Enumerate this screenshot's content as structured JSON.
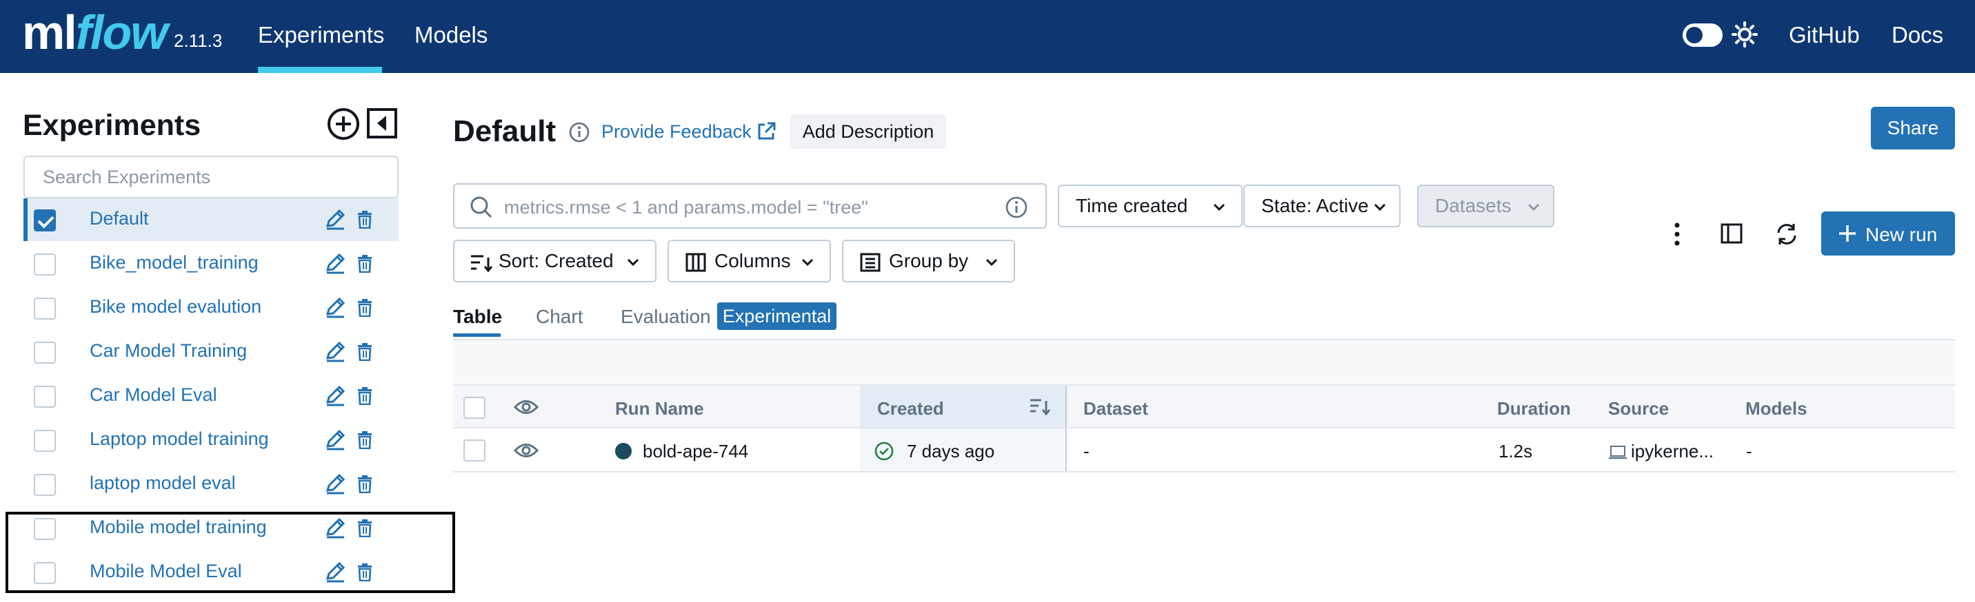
{
  "app": {
    "logo_ml": "ml",
    "logo_flow": "flow",
    "version": "2.11.3",
    "nav": [
      {
        "label": "Experiments",
        "active": true
      },
      {
        "label": "Models",
        "active": false
      }
    ],
    "right_links": [
      "GitHub",
      "Docs"
    ],
    "theme_toggle": "off",
    "colors": {
      "header": "#0e3772",
      "accent": "#43c9ed",
      "primary": "#2272b4"
    }
  },
  "sidebar": {
    "title": "Experiments",
    "search_placeholder": "Search Experiments",
    "experiments": [
      {
        "name": "Default",
        "checked": true
      },
      {
        "name": "Bike_model_training",
        "checked": false
      },
      {
        "name": "Bike model evalution",
        "checked": false
      },
      {
        "name": "Car Model Training",
        "checked": false
      },
      {
        "name": "Car Model Eval",
        "checked": false
      },
      {
        "name": "Laptop model training",
        "checked": false
      },
      {
        "name": "laptop model eval",
        "checked": false
      },
      {
        "name": "Mobile model training",
        "checked": false
      },
      {
        "name": "Mobile Model Eval",
        "checked": false
      }
    ]
  },
  "main": {
    "title": "Default",
    "feedback_label": "Provide Feedback",
    "add_description_label": "Add Description",
    "share_label": "Share",
    "search_placeholder": "metrics.rmse < 1 and params.model = \"tree\"",
    "filters": {
      "time_created": "Time created",
      "state": "State: Active",
      "datasets": "Datasets"
    },
    "sort_label": "Sort: Created",
    "columns_label": "Columns",
    "group_by_label": "Group by",
    "new_run_label": "New run",
    "tabs": [
      {
        "label": "Table",
        "active": true
      },
      {
        "label": "Chart",
        "active": false
      },
      {
        "label": "Evaluation",
        "active": false
      }
    ],
    "experimental_badge": "Experimental",
    "table": {
      "headers": [
        "Run Name",
        "Created",
        "Dataset",
        "Duration",
        "Source",
        "Models"
      ],
      "rows": [
        {
          "run_name": "bold-ape-744",
          "created": "7 days ago",
          "dataset": "-",
          "duration": "1.2s",
          "source": "ipykerne...",
          "models": "-"
        }
      ]
    }
  }
}
